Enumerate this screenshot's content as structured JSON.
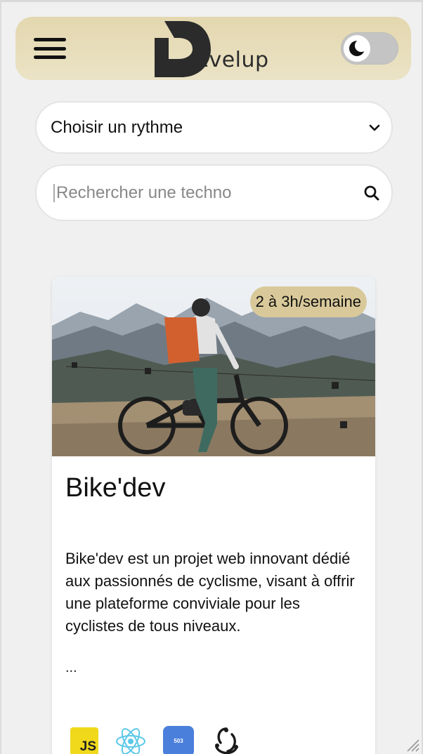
{
  "header": {
    "logo_text": "Evelup",
    "theme_toggle": "dark-mode-toggle"
  },
  "filters": {
    "rhythm_select": "Choisir un rythme",
    "search_placeholder": "Rechercher une techno"
  },
  "card": {
    "badge": "2 à 3h/semaine",
    "title": "Bike'dev",
    "description": "Bike'dev est un projet web innovant dédié aux passionnés de cyclisme, visant à offrir une plateforme conviviale pour les cyclistes de tous niveaux.",
    "ellipsis": "...",
    "techs": [
      {
        "icon": "javascript-icon",
        "label": "JS"
      },
      {
        "icon": "react-icon"
      },
      {
        "icon": "api-doc-icon",
        "label": "503"
      },
      {
        "icon": "redux-icon"
      }
    ]
  },
  "colors": {
    "header_bg": "#e3d7ae",
    "badge_bg": "#d9c99a",
    "page_bg": "#f0f0f0"
  }
}
